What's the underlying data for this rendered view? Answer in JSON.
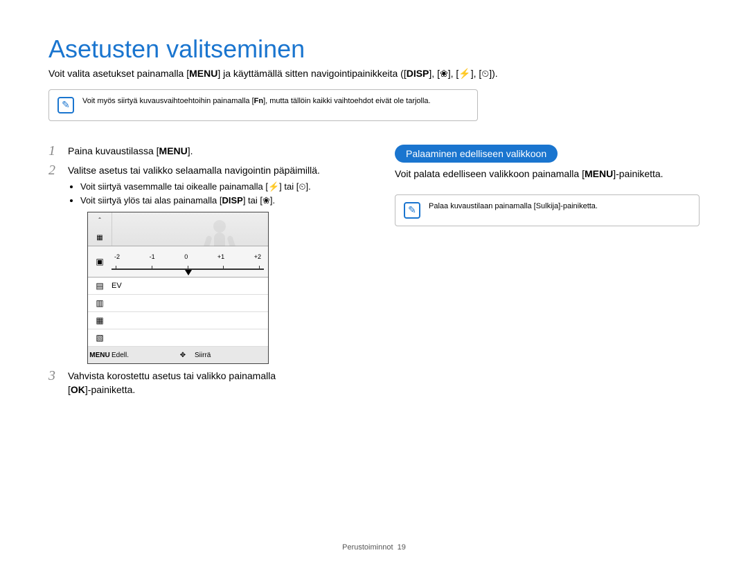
{
  "title": "Asetusten valitseminen",
  "intro_a": "Voit valita asetukset painamalla [",
  "intro_menu": "MENU",
  "intro_b": "] ja käyttämällä sitten navigointipainikkeita ([",
  "intro_disp": "DISP",
  "intro_c": "], [",
  "icon_macro": "❀",
  "intro_d": "], [",
  "icon_flash": "⚡",
  "intro_e": "], [",
  "icon_timer": "⏲",
  "intro_f": "]).",
  "note1_a": "Voit myös siirtyä kuvausvaihtoehtoihin painamalla [",
  "note1_fn": "Fn",
  "note1_b": "], mutta tällöin kaikki vaihtoehdot eivät ole tarjolla.",
  "step1_a": "Paina kuvaustilassa [",
  "step1_menu": "MENU",
  "step1_b": "].",
  "step2": "Valitse asetus tai valikko selaamalla navigointin päpäimillä.",
  "step2_s1_a": "Voit siirtyä vasemmalle tai oikealle painamalla [",
  "step2_s1_i1": "⚡",
  "step2_s1_b": "] tai [",
  "step2_s1_i2": "⏲",
  "step2_s1_c": "].",
  "step2_s2_a": "Voit siirtyä ylös tai alas painamalla [",
  "step2_s2_i1": "DISP",
  "step2_s2_b": "] tai [",
  "step2_s2_i2": "❀",
  "step2_s2_c": "].",
  "lcd": {
    "scale_labels": [
      "-2",
      "-1",
      "0",
      "+1",
      "+2"
    ],
    "ev_label": "EV",
    "bottom_menu": "MENU",
    "bottom_back": "Edell.",
    "bottom_move_icon": "✥",
    "bottom_move": "Siirrä"
  },
  "step3_a": "Vahvista korostettu asetus tai valikko painamalla",
  "step3_b": "[",
  "step3_ok": "OK",
  "step3_c": "]-painiketta.",
  "pill": "Palaaminen edelliseen valikkoon",
  "right_para_a": "Voit palata edelliseen valikkoon painamalla [",
  "right_para_menu": "MENU",
  "right_para_b": "]-painiketta.",
  "note2": "Palaa kuvaustilaan painamalla [Sulkija]-painiketta.",
  "footer_a": "Perustoiminnot",
  "footer_b": "19"
}
